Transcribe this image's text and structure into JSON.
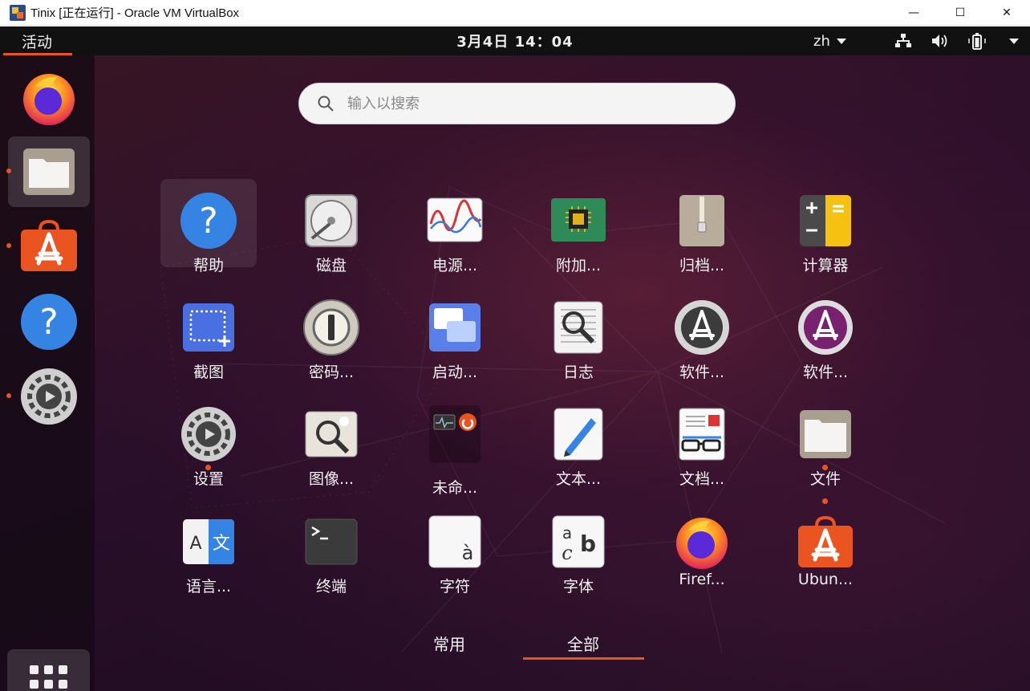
{
  "window": {
    "title": "Tinix [正在运行] - Oracle VM VirtualBox",
    "minimize": "—",
    "maximize": "☐",
    "close": "✕"
  },
  "topbar": {
    "activities": "活动",
    "clock": "3月4日  14：04",
    "lang": "zh"
  },
  "search": {
    "placeholder": "输入以搜索"
  },
  "apps": [
    {
      "label": "帮助",
      "icon": "help-icon"
    },
    {
      "label": "磁盘",
      "icon": "disks-icon"
    },
    {
      "label": "电源...",
      "icon": "power-statistics-icon"
    },
    {
      "label": "附加...",
      "icon": "additional-drivers-icon"
    },
    {
      "label": "归档...",
      "icon": "archive-manager-icon"
    },
    {
      "label": "计算器",
      "icon": "calculator-icon"
    },
    {
      "label": "截图",
      "icon": "screenshot-icon"
    },
    {
      "label": "密码...",
      "icon": "passwords-keys-icon"
    },
    {
      "label": "启动...",
      "icon": "startup-apps-icon"
    },
    {
      "label": "日志",
      "icon": "logs-icon"
    },
    {
      "label": "软件...",
      "icon": "software-updater-icon"
    },
    {
      "label": "软件...",
      "icon": "software-properties-icon"
    },
    {
      "label": "设置",
      "icon": "settings-icon"
    },
    {
      "label": "图像...",
      "icon": "image-viewer-icon"
    },
    {
      "label": "未命...",
      "icon": "unnamed-folder-icon"
    },
    {
      "label": "文本...",
      "icon": "text-editor-icon"
    },
    {
      "label": "文档...",
      "icon": "document-viewer-icon"
    },
    {
      "label": "文件",
      "icon": "files-icon"
    },
    {
      "label": "语言...",
      "icon": "language-support-icon"
    },
    {
      "label": "终端",
      "icon": "terminal-icon"
    },
    {
      "label": "字符",
      "icon": "characters-icon"
    },
    {
      "label": "字体",
      "icon": "fonts-icon"
    },
    {
      "label": "Firef...",
      "icon": "firefox-icon"
    },
    {
      "label": "Ubun...",
      "icon": "ubuntu-software-icon"
    }
  ],
  "tabs": {
    "frequent": "常用",
    "all": "全部",
    "selected": "all"
  },
  "dock": [
    "firefox-icon",
    "files-icon",
    "ubuntu-software-icon",
    "help-icon",
    "settings-icon",
    "show-applications-icon"
  ]
}
